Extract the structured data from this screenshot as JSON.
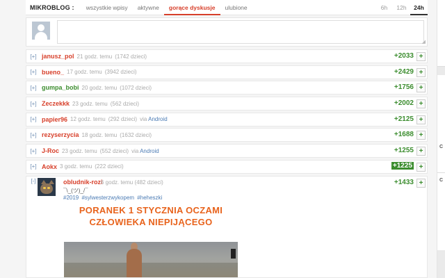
{
  "header": {
    "brand": "MIKROBLOG :",
    "tabs": [
      {
        "label": "wszystkie wpisy",
        "active": false
      },
      {
        "label": "aktywne",
        "active": false
      },
      {
        "label": "gorące dyskusje",
        "active": true
      },
      {
        "label": "ulubione",
        "active": false
      }
    ],
    "time_filters": [
      {
        "label": "6h",
        "active": false
      },
      {
        "label": "12h",
        "active": false
      },
      {
        "label": "24h",
        "active": true
      }
    ]
  },
  "composer": {
    "avatar_icon": "default-user-avatar",
    "input_value": ""
  },
  "entries": [
    {
      "expand": "[+]",
      "author": "janusz_pol",
      "author_color": "orange",
      "time": "21 godz. temu",
      "replies": "(1742 dzieci)",
      "via": "",
      "platform": "",
      "score": "+2033",
      "highlight": false
    },
    {
      "expand": "[+]",
      "author": "bueno_",
      "author_color": "orange",
      "time": "17 godz. temu",
      "replies": "(3942 dzieci)",
      "via": "",
      "platform": "",
      "score": "+2429",
      "highlight": false
    },
    {
      "expand": "[+]",
      "author": "gumpa_bobi",
      "author_color": "green",
      "time": "20 godz. temu",
      "replies": "(1072 dzieci)",
      "via": "",
      "platform": "",
      "score": "+1756",
      "highlight": false
    },
    {
      "expand": "[+]",
      "author": "Zeczekkk",
      "author_color": "orange",
      "time": "23 godz. temu",
      "replies": "(562 dzieci)",
      "via": "",
      "platform": "",
      "score": "+2002",
      "highlight": false
    },
    {
      "expand": "[+]",
      "author": "papier96",
      "author_color": "orange",
      "time": "12 godz. temu",
      "replies": "(292 dzieci)",
      "via": "via",
      "platform": "Android",
      "score": "+2125",
      "highlight": false
    },
    {
      "expand": "[+]",
      "author": "rezyserzycia",
      "author_color": "orange",
      "time": "18 godz. temu",
      "replies": "(1632 dzieci)",
      "via": "",
      "platform": "",
      "score": "+1688",
      "highlight": false
    },
    {
      "expand": "[+]",
      "author": "J-Roc",
      "author_color": "orange",
      "time": "23 godz. temu",
      "replies": "(552 dzieci)",
      "via": "via",
      "platform": "Android",
      "score": "+1255",
      "highlight": false
    },
    {
      "expand": "[+]",
      "author": "Aokx",
      "author_color": "orange",
      "time": "3 godz. temu",
      "replies": "(222 dzieci)",
      "via": "",
      "platform": "",
      "score": "+1225",
      "highlight": true
    }
  ],
  "expanded_entry": {
    "expand": "[-]",
    "author": "obludnik-rozi",
    "time": "6 godz. temu",
    "replies": "(482 dzieci)",
    "score": "+1433",
    "shrug": "¯\\_(ツ)_/¯",
    "tags": [
      "#2019",
      "#sylwesterzwykopem",
      "#heheszki"
    ],
    "meme_caption_line1": "PORANEK 1 STYCZNIA OCZAMI",
    "meme_caption_line2": "CZŁOWIEKA NIEPIJĄCEGO",
    "avatar_icon": "cat-avatar"
  },
  "plus_label": "+",
  "colors": {
    "accent": "#d73f2a",
    "score_green": "#3c8d2f",
    "link_blue": "#4b7bb4",
    "meme_orange": "#e8631c"
  }
}
